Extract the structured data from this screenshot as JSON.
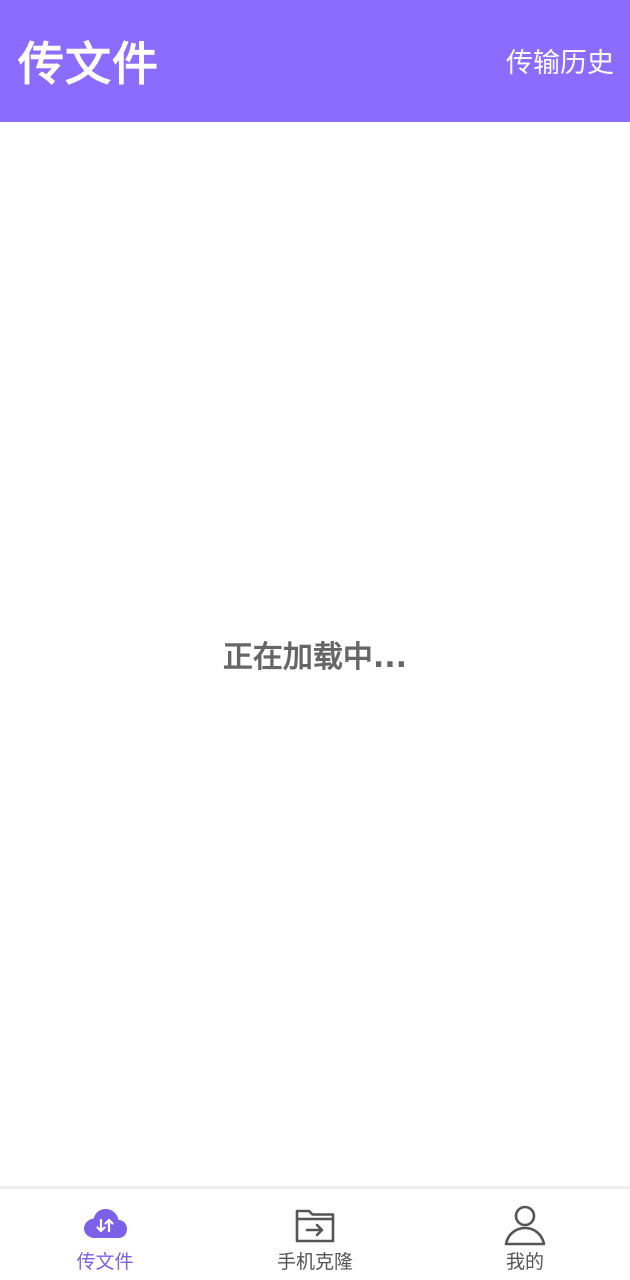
{
  "header": {
    "title": "传文件",
    "history_link": "传输历史"
  },
  "main": {
    "loading_text": "正在加载中..."
  },
  "bottom_nav": {
    "items": [
      {
        "label": "传文件",
        "icon": "cloud-transfer-icon",
        "active": true
      },
      {
        "label": "手机克隆",
        "icon": "folder-transfer-icon",
        "active": false
      },
      {
        "label": "我的",
        "icon": "user-icon",
        "active": false
      }
    ]
  },
  "colors": {
    "brand": "#8b6cff",
    "active_tab": "#7b61e8",
    "inactive_tab": "#555555",
    "loading_text": "#666666"
  }
}
